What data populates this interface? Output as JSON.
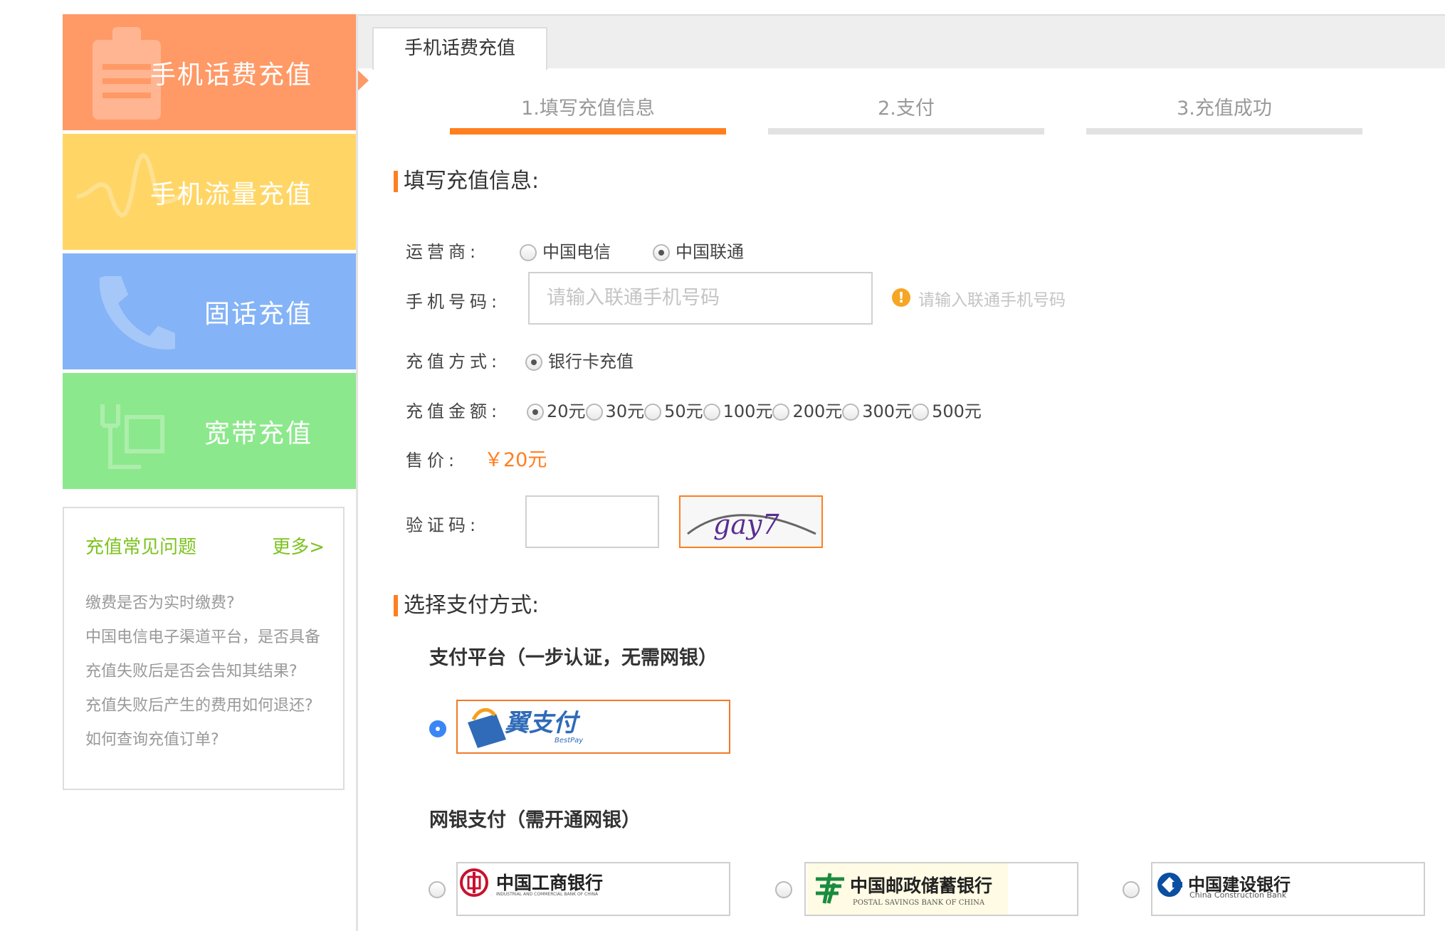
{
  "sidebar": {
    "items": [
      {
        "label": "手机话费充值"
      },
      {
        "label": "手机流量充值"
      },
      {
        "label": "固话充值"
      },
      {
        "label": "宽带充值"
      }
    ]
  },
  "faq": {
    "title": "充值常见问题",
    "more": "更多>",
    "items": [
      "缴费是否为实时缴费?",
      "中国电信电子渠道平台，是否具备",
      "充值失败后是否会告知其结果?",
      "充值失败后产生的费用如何退还?",
      "如何查询充值订单?"
    ]
  },
  "tab": {
    "label": "手机话费充值"
  },
  "steps": [
    {
      "label": "1.填写充值信息",
      "active": true
    },
    {
      "label": "2.支付",
      "active": false
    },
    {
      "label": "3.充值成功",
      "active": false
    }
  ],
  "form": {
    "section_title": "填写充值信息:",
    "carrier_label": "运营商:",
    "carrier_options": [
      "中国电信",
      "中国联通"
    ],
    "carrier_selected": "中国联通",
    "phone_label": "手机号码:",
    "phone_placeholder": "请输入联通手机号码",
    "phone_hint": "请输入联通手机号码",
    "method_label": "充值方式:",
    "method_option": "银行卡充值",
    "amount_label": "充值金额:",
    "amount_options": [
      "20元",
      "30元",
      "50元",
      "100元",
      "200元",
      "300元",
      "500元"
    ],
    "amount_selected": "20元",
    "price_label": "售价:",
    "price_value": "￥20元",
    "captcha_label": "验证码:",
    "captcha_text": "gay7"
  },
  "payment": {
    "section_title": "选择支付方式:",
    "platform_title": "支付平台（一步认证，无需网银）",
    "platform_name": "翼支付",
    "platform_sub": "BestPay",
    "bank_title": "网银支付（需开通网银）",
    "banks": [
      {
        "name": "中国工商银行",
        "en": "INDUSTRIAL AND COMMERCIAL BANK OF CHINA"
      },
      {
        "name": "中国邮政储蓄银行",
        "en": "POSTAL SAVINGS BANK OF CHINA"
      },
      {
        "name": "中国建设银行",
        "en": "China Construction Bank"
      }
    ]
  },
  "colors": {
    "accent": "#ff7f1f",
    "faq_green": "#7cc31f",
    "sidebar_orange": "#ff9966",
    "sidebar_yellow": "#ffd666",
    "sidebar_blue": "#84b3f7",
    "sidebar_green": "#8ce88c"
  }
}
